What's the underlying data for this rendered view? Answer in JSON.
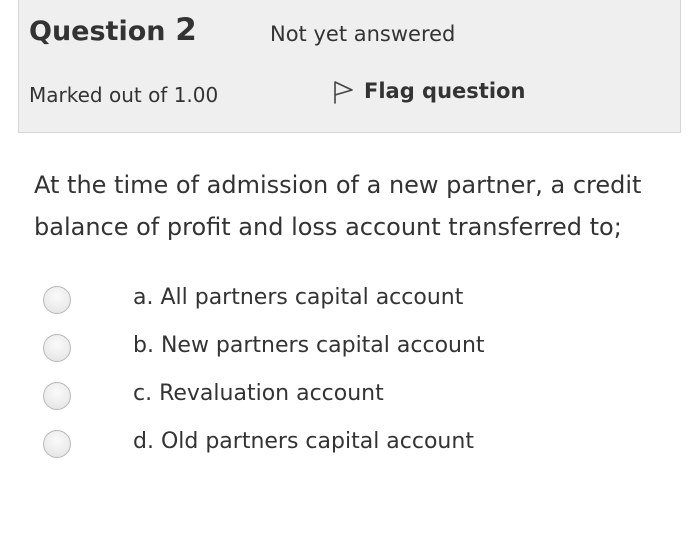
{
  "question": {
    "word": "Question",
    "number": "2",
    "status": "Not yet answered",
    "grade": "Marked out of 1.00",
    "flag_label": "Flag question",
    "flag_icon": "flag-icon",
    "text": "At the time of admission of a new partner, a credit balance of profit and loss account transferred to;"
  },
  "answers": [
    {
      "label": "a. All partners capital account",
      "selected": false
    },
    {
      "label": "b. New partners capital account",
      "selected": false
    },
    {
      "label": "c. Revaluation account",
      "selected": false
    },
    {
      "label": "d. Old partners capital account",
      "selected": false
    }
  ]
}
